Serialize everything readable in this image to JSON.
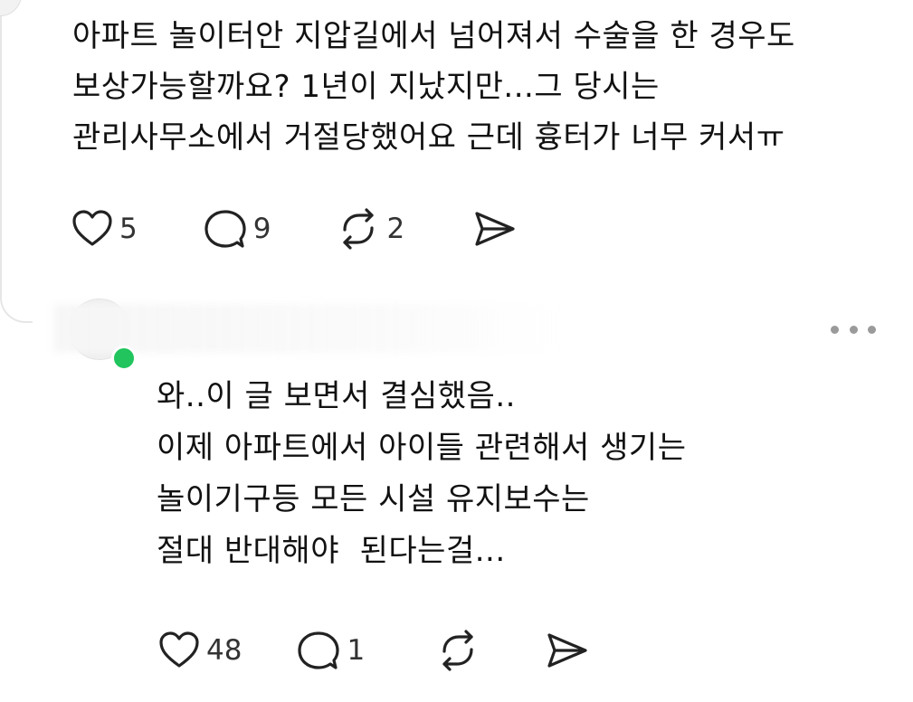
{
  "post": {
    "text_lines": [
      "아파트 놀이터안 지압길에서 넘어져서 수술을 한 경우도",
      "보상가능할까요? 1년이 지났지만...그 당시는",
      "관리사무소에서 거절당했어요 근데 흉터가 너무 커서ㅠ"
    ],
    "actions": {
      "like_count": "5",
      "reply_count": "9",
      "repost_count": "2"
    }
  },
  "comment": {
    "text_lines": [
      "와..이 글 보면서 결심했음..",
      "이제 아파트에서 아이들 관련해서 생기는",
      "놀이기구등 모든 시설 유지보수는",
      "절대 반대해야  된다는걸..."
    ],
    "actions": {
      "like_count": "48",
      "reply_count": "1"
    },
    "online_status_color": "#21c45d"
  },
  "icons": {
    "like": "heart-icon",
    "reply": "comment-bubble-icon",
    "repost": "repost-icon",
    "share": "send-icon",
    "more": "more-options-icon"
  }
}
